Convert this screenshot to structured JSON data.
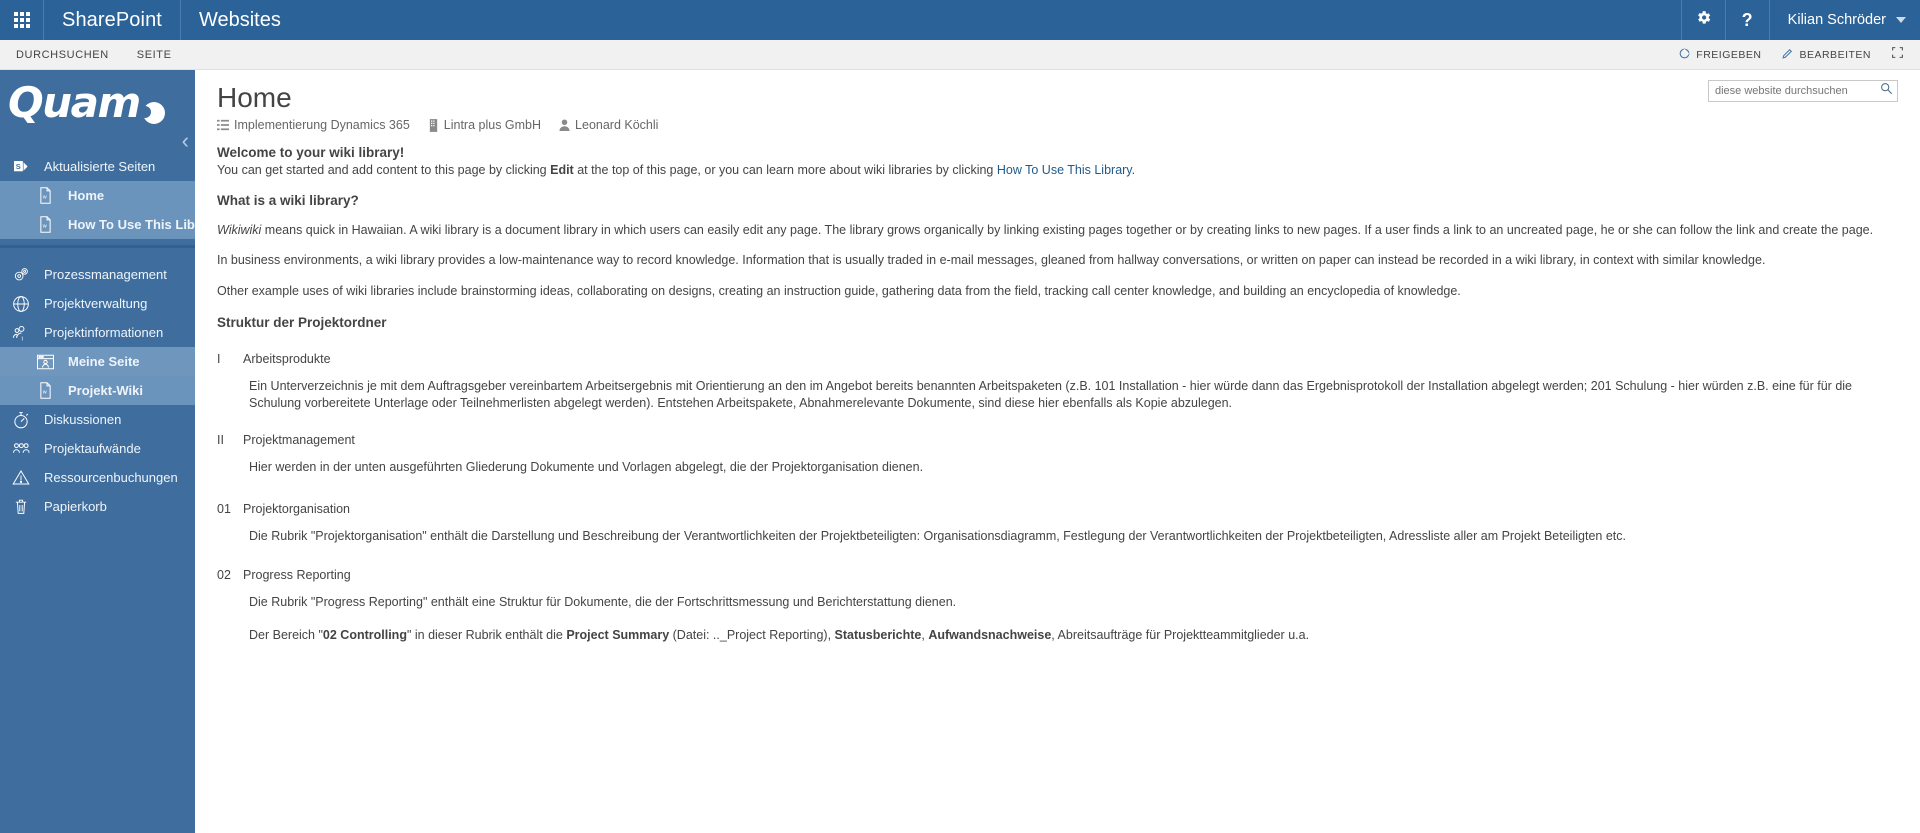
{
  "suite": {
    "waffle_icon": "app-launcher-icon",
    "brand": "SharePoint",
    "site": "Websites",
    "settings_icon": "gear-icon",
    "help_icon": "question-mark-icon",
    "user_name": "Kilian Schröder",
    "user_caret_icon": "chevron-down-icon"
  },
  "ribbon": {
    "tabs": [
      "DURCHSUCHEN",
      "SEITE"
    ],
    "share_label": "FREIGEBEN",
    "share_icon": "share-icon",
    "edit_label": "BEARBEITEN",
    "edit_icon": "pencil-icon",
    "focus_icon": "focus-on-content-icon"
  },
  "sidebar": {
    "logo_text": "Quam",
    "logo_mark_icon": "quam-dot-icon",
    "collapse_icon": "chevron-left-icon",
    "groups": [
      {
        "items": [
          {
            "label": "Aktualisierte Seiten",
            "icon": "sharepoint-logo-icon",
            "selected": false,
            "sub": false
          },
          {
            "label": "Home",
            "icon": "wiki-page-icon",
            "selected": true,
            "sub": true
          },
          {
            "label": "How To Use This Library",
            "icon": "wiki-page-icon",
            "selected": true,
            "sub": true
          }
        ]
      },
      {
        "items": [
          {
            "label": "Prozessmanagement",
            "icon": "gears-icon",
            "selected": false,
            "sub": false
          },
          {
            "label": "Projektverwaltung",
            "icon": "globe-icon",
            "selected": false,
            "sub": false
          },
          {
            "label": "Projektinformationen",
            "icon": "people-info-icon",
            "selected": false,
            "sub": false
          },
          {
            "label": "Meine Seite",
            "icon": "browser-person-icon",
            "selected": true,
            "sub": true
          },
          {
            "label": "Projekt-Wiki",
            "icon": "wiki-page-icon",
            "selected": true,
            "sub": true
          },
          {
            "label": "Diskussionen",
            "icon": "stopwatch-icon",
            "selected": false,
            "sub": false
          },
          {
            "label": "Projektaufwände",
            "icon": "group-effort-icon",
            "selected": false,
            "sub": false
          },
          {
            "label": "Ressourcenbuchungen",
            "icon": "warning-triangle-icon",
            "selected": false,
            "sub": false
          },
          {
            "label": "Papierkorb",
            "icon": "recycle-bin-icon",
            "selected": false,
            "sub": false
          }
        ]
      }
    ]
  },
  "search": {
    "placeholder": "diese website durchsuchen",
    "value": "",
    "icon": "search-icon"
  },
  "page": {
    "title": "Home",
    "meta": [
      {
        "label": "Implementierung Dynamics 365",
        "icon": "list-icon"
      },
      {
        "label": "Lintra plus GmbH",
        "icon": "building-icon"
      },
      {
        "label": "Leonard Köchli",
        "icon": "person-icon"
      }
    ]
  },
  "content": {
    "welcome_heading": "Welcome to your wiki library!",
    "welcome_p1_a": "You can get started and add content to this page by clicking ",
    "welcome_p1_bold": "Edit",
    "welcome_p1_b": " at the top of this page, or you can learn more about wiki libraries by clicking ",
    "welcome_p1_link": "How To Use This Library",
    "welcome_p1_c": ".",
    "what_heading": "What is a wiki library?",
    "wikiwiki_italic": "Wikiwiki",
    "wikiwiki_rest": " means quick in Hawaiian. A wiki library is a document library in which users can easily edit any page. The library grows organically by linking existing pages together or by creating links to new pages. If a user finds a link to an uncreated page, he or she can follow the link and create the page.",
    "business_p": "In business environments, a wiki library provides a low-maintenance way to record knowledge. Information that is usually traded in e-mail messages, gleaned from hallway conversations, or written on paper can instead be recorded in a wiki library, in context with similar knowledge.",
    "other_p": "Other example uses of wiki libraries include brainstorming ideas, collaborating on designs, creating an instruction guide, gathering data from the field, tracking call center knowledge, and building an encyclopedia of knowledge.",
    "struktur_heading": "Struktur der Projektordner",
    "sections": [
      {
        "num": "I",
        "name": "Arbeitsprodukte",
        "body": "Ein Unterverzeichnis je mit dem Auftragsgeber vereinbartem Arbeitsergebnis mit Orientierung an den im Angebot bereits benannten Arbeitspaketen (z.B. 101 Installation - hier würde dann das Ergebnisprotokoll der Installation abgelegt werden; 201 Schulung - hier würden z.B. eine für für die Schulung vorbereitete Unterlage oder Teilnehmerlisten abgelegt werden). Entstehen Arbeitspakete, Abnahmerelevante Dokumente, sind diese hier ebenfalls als Kopie abzulegen."
      },
      {
        "num": "II",
        "name": "Projektmanagement",
        "body": "Hier werden in der unten ausgeführten Gliederung Dokumente und Vorlagen abgelegt, die der Projektorganisation dienen."
      },
      {
        "num": "01",
        "name": "Projektorganisation",
        "body": "Die Rubrik \"Projektorganisation\" enthält die Darstellung und Beschreibung der Verantwortlichkeiten der Projektbeteiligten: Organisationsdiagramm, Festlegung der Verantwortlichkeiten der Projektbeteiligten, Adressliste aller am Projekt Beteiligten etc."
      },
      {
        "num": "02",
        "name": "Progress Reporting",
        "body": "Die Rubrik \"Progress Reporting\" enthält eine Struktur für Dokumente, die der Fortschrittsmessung und Berichterstattung dienen."
      }
    ],
    "controlling_a": "Der Bereich \"",
    "controlling_b1": "02 Controlling",
    "controlling_c": "\" in dieser Rubrik enthält die ",
    "controlling_b2": "Project Summary",
    "controlling_d": " (Datei: .._Project Reporting), ",
    "controlling_b3": "Statusberichte",
    "controlling_e": ", ",
    "controlling_b4": "Aufwandsnachweise",
    "controlling_f": ", Abreitsaufträge für Projektteammitglieder u.a."
  },
  "colors": {
    "suite_bar": "#2b6298",
    "sidebar": "#3f6e9e",
    "sidebar_selected": "#6b94bd",
    "link": "#1f5a8c",
    "ribbon_bg": "#f1f1f1"
  }
}
